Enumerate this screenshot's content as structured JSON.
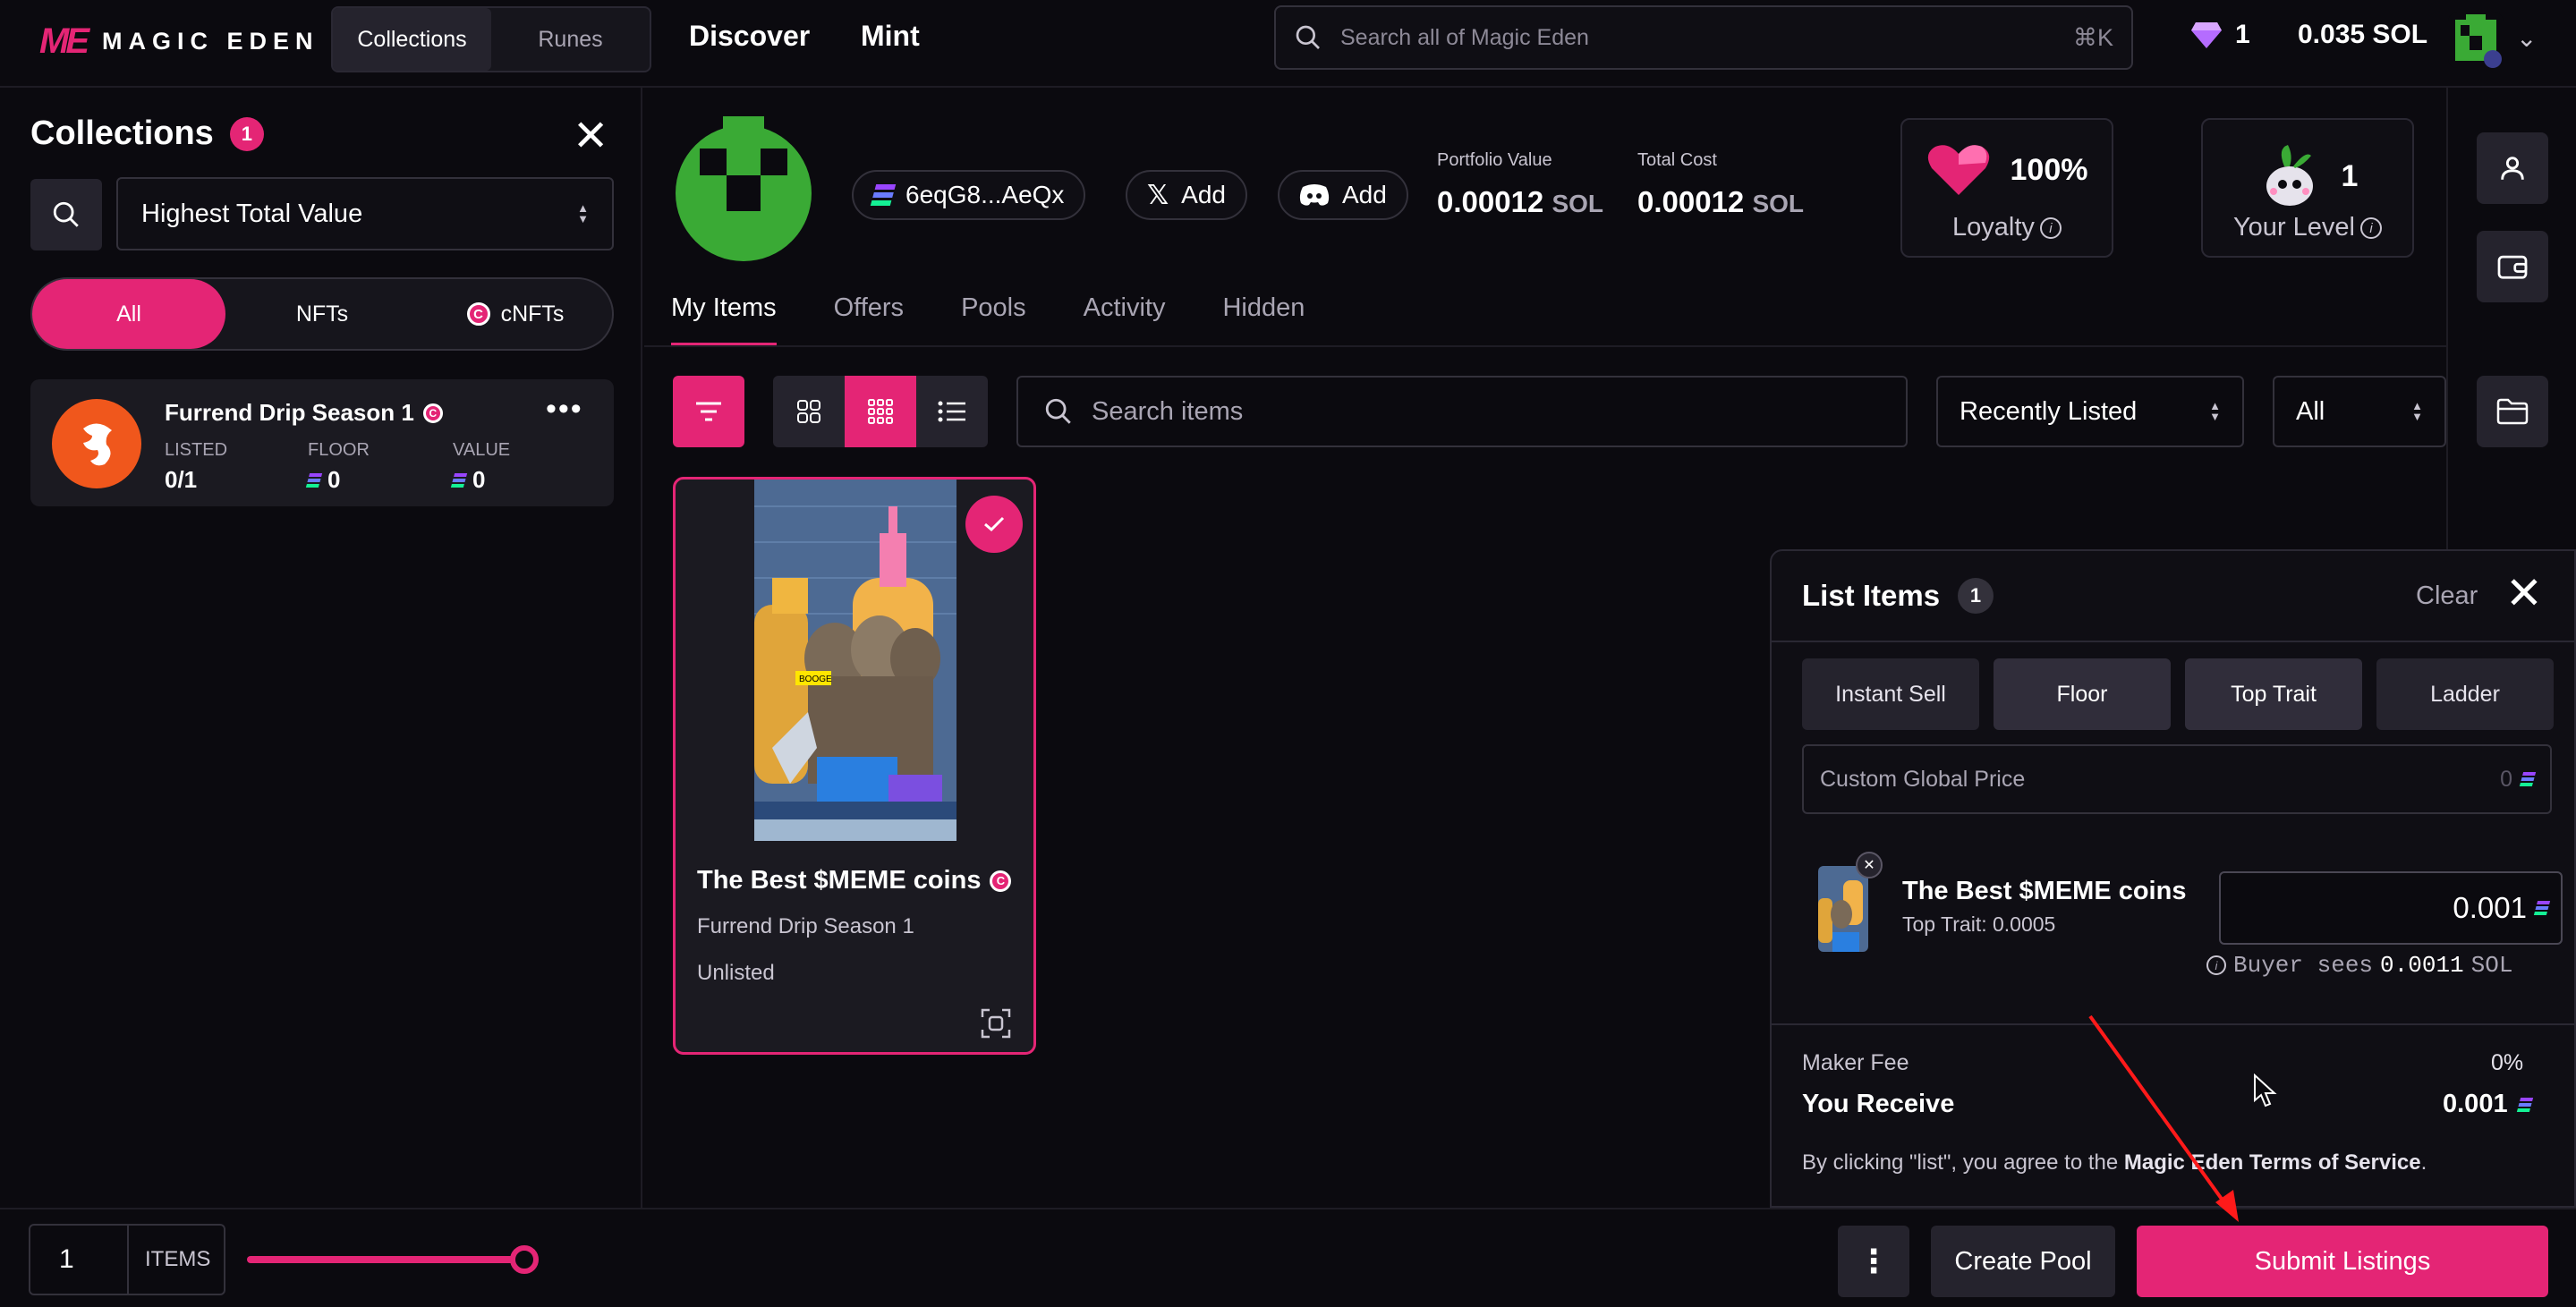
{
  "brand": {
    "logo_mark": "ME",
    "logo_text": "MAGIC EDEN",
    "accent": "#e42575"
  },
  "topbar": {
    "switch": [
      "Collections",
      "Runes"
    ],
    "nav": [
      "Discover",
      "Mint"
    ],
    "search_placeholder": "Search all of Magic Eden",
    "search_shortcut": "⌘K",
    "gems": "1",
    "balance": "0.035 SOL"
  },
  "sidebar": {
    "title": "Collections",
    "count": "1",
    "sort": "Highest Total Value",
    "type_tabs": [
      "All",
      "NFTs",
      "cNFTs"
    ],
    "collection": {
      "name": "Furrend Drip Season 1",
      "listed_label": "LISTED",
      "listed_value": "0/1",
      "floor_label": "FLOOR",
      "floor_value": "0",
      "value_label": "VALUE",
      "value_value": "0"
    }
  },
  "profile": {
    "wallet": "6eqG8...AeQx",
    "x_label": "Add",
    "discord_label": "Add",
    "portfolio_label": "Portfolio Value",
    "portfolio_value": "0.00012",
    "total_cost_label": "Total Cost",
    "total_cost_value": "0.00012",
    "currency": "SOL",
    "loyalty_value": "100%",
    "loyalty_label": "Loyalty",
    "level_value": "1",
    "level_label": "Your Level"
  },
  "tabs": [
    "My Items",
    "Offers",
    "Pools",
    "Activity",
    "Hidden"
  ],
  "toolbar": {
    "search_placeholder": "Search items",
    "sort": "Recently Listed",
    "filter": "All"
  },
  "nft": {
    "name": "The Best $MEME coins",
    "collection": "Furrend Drip Season 1",
    "status": "Unlisted",
    "sign_text": "BOOGE"
  },
  "list_panel": {
    "title": "List Items",
    "count": "1",
    "clear": "Clear",
    "modes": [
      "Instant Sell",
      "Floor",
      "Top Trait",
      "Ladder"
    ],
    "custom_price_label": "Custom Global Price",
    "custom_price_value": "0",
    "item_name": "The Best $MEME coins",
    "item_trait": "Top Trait: 0.0005",
    "item_price": "0.001",
    "buyer_prefix": "Buyer sees",
    "buyer_value": "0.0011",
    "buyer_unit": "SOL",
    "maker_fee_label": "Maker Fee",
    "maker_fee_value": "0%",
    "receive_label": "You Receive",
    "receive_value": "0.001",
    "terms_prefix": "By clicking \"list\", you agree to the",
    "terms_link": "Magic Eden Terms of Service",
    "terms_suffix": "."
  },
  "bottombar": {
    "quantity": "1",
    "items_label": "ITEMS",
    "more": "⋮",
    "create_pool": "Create Pool",
    "submit": "Submit Listings"
  }
}
